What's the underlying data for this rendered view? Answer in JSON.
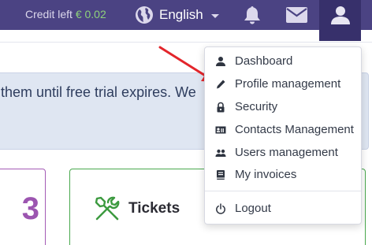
{
  "header": {
    "credit_label": "Credit left",
    "credit_amount": "€ 0.02",
    "language": "English",
    "icons": [
      "globe-icon",
      "bell-icon",
      "mail-icon",
      "user-icon"
    ]
  },
  "banner": {
    "text": "them until free trial expires. We"
  },
  "cards": [
    {
      "value": "3"
    },
    {
      "title": "Tickets",
      "icon": "tools-icon"
    }
  ],
  "user_menu": {
    "items": [
      {
        "label": "Dashboard",
        "icon": "person-icon"
      },
      {
        "label": "Profile management",
        "icon": "pencil-icon"
      },
      {
        "label": "Security",
        "icon": "lock-icon"
      },
      {
        "label": "Contacts Management",
        "icon": "contact-card-icon"
      },
      {
        "label": "Users management",
        "icon": "users-icon"
      },
      {
        "label": "My invoices",
        "icon": "invoice-book-icon"
      },
      {
        "label": "Logout",
        "icon": "power-icon"
      }
    ]
  },
  "colors": {
    "topbar": "#4b4383",
    "topbar_active": "#37306b",
    "credit_amount": "#8ed27a",
    "annotation_arrow": "#e3252b",
    "card_purple": "#9c55b0",
    "card_green": "#49a84d"
  }
}
